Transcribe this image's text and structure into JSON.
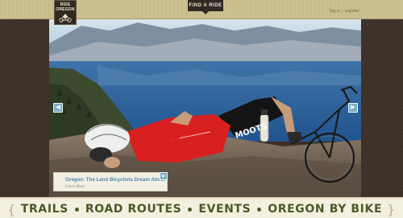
{
  "header": {
    "logo_line1": "RIDE",
    "logo_line2": "OREGON",
    "find_ride_label": "FIND A RIDE",
    "login_label": "log in",
    "register_label": "register"
  },
  "hero": {
    "prev_icon": "arrow-left-icon",
    "next_icon": "arrow-right-icon",
    "caption_title": "Oregon: The Land Bicyclists Dream About",
    "caption_link": "Learn More",
    "jersey_text": "MOOTS"
  },
  "nav": {
    "items": [
      {
        "label": "TRAILS"
      },
      {
        "label": "ROAD ROUTES"
      },
      {
        "label": "EVENTS"
      },
      {
        "label": "OREGON BY BIKE"
      }
    ]
  },
  "colors": {
    "brown": "#3e3129",
    "tan": "#cdc08f",
    "accent_blue": "#4f86a6",
    "nav_green": "#4a5a27"
  }
}
